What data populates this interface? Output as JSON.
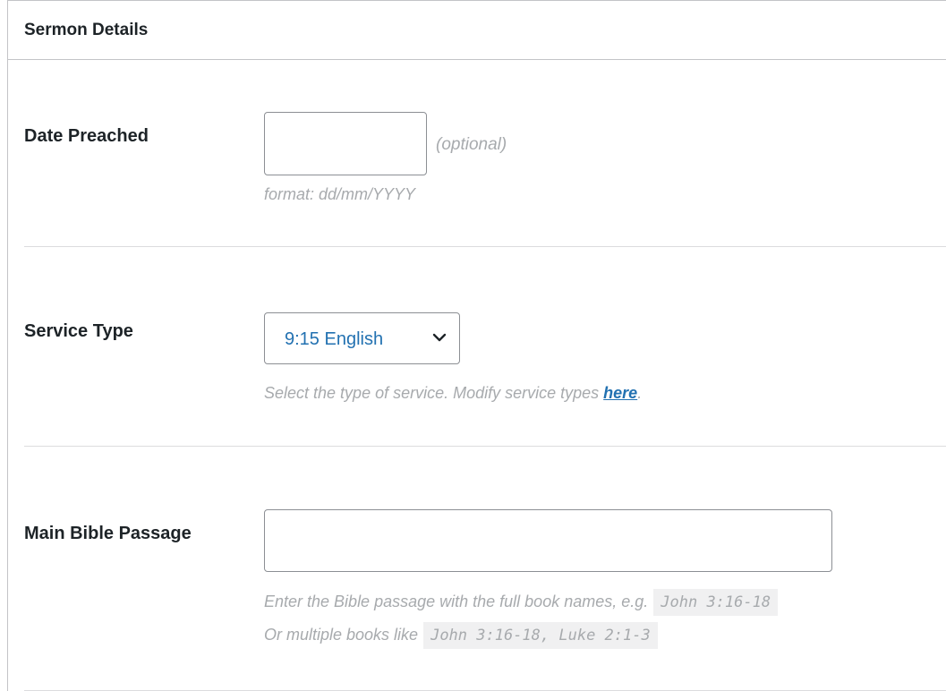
{
  "panel": {
    "title": "Sermon Details"
  },
  "date_preached": {
    "label": "Date Preached",
    "value": "",
    "optional_note": "(optional)",
    "format_hint": "format: dd/mm/YYYY"
  },
  "service_type": {
    "label": "Service Type",
    "selected": "9:15 English",
    "description": "Select the type of service. Modify service types ",
    "link_text": "here",
    "link_suffix": "."
  },
  "main_bible_passage": {
    "label": "Main Bible Passage",
    "value": "",
    "hint_line1": "Enter the Bible passage with the full book names, e.g.",
    "example1": "John 3:16-18",
    "hint_line2": "Or multiple books like",
    "example2": "John 3:16-18, Luke 2:1-3"
  },
  "icons": {
    "select_chevron": "chevron-down-icon"
  }
}
